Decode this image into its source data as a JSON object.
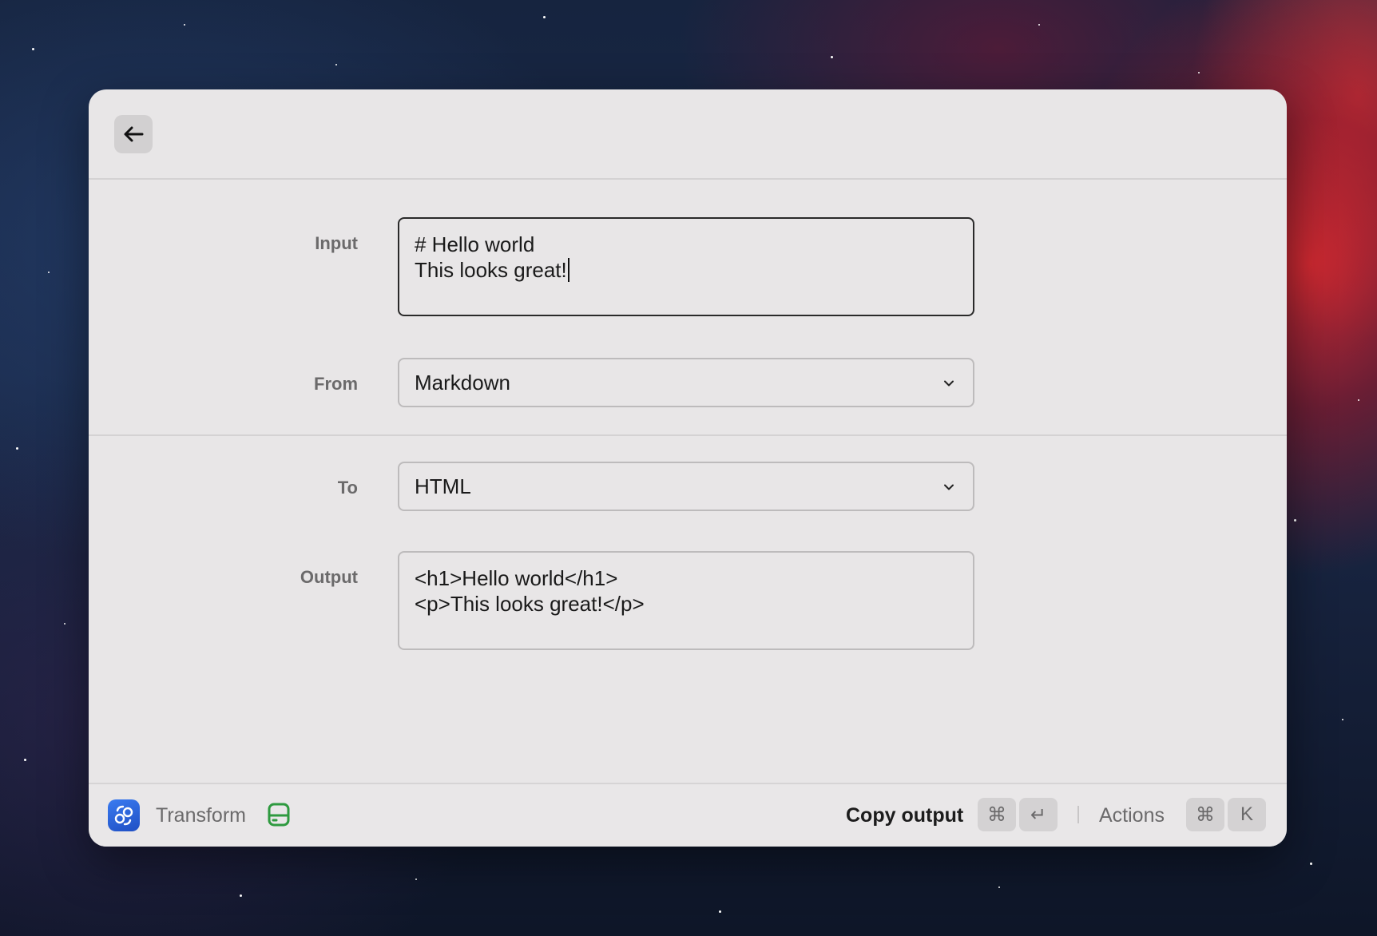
{
  "header": {
    "back_icon": "arrow-left-icon"
  },
  "form": {
    "input": {
      "label": "Input",
      "line1": "# Hello world",
      "line2": "This looks great!"
    },
    "from": {
      "label": "From",
      "value": "Markdown"
    },
    "to": {
      "label": "To",
      "value": "HTML"
    },
    "output": {
      "label": "Output",
      "line1": "<h1>Hello world</h1>",
      "line2": "<p>This looks great!</p>"
    }
  },
  "footer": {
    "app_name": "Transform",
    "app_icon": "transform-app-icon",
    "status_icon": "drive-icon",
    "primary_action": "Copy output",
    "primary_shortcut_mod": "⌘",
    "primary_shortcut_key": "↵",
    "secondary_action": "Actions",
    "secondary_shortcut_mod": "⌘",
    "secondary_shortcut_key": "K"
  },
  "colors": {
    "window_bg": "#e8e6e7",
    "app_icon_blue": "#2f66e0",
    "drive_icon_green": "#2e9a3f"
  }
}
